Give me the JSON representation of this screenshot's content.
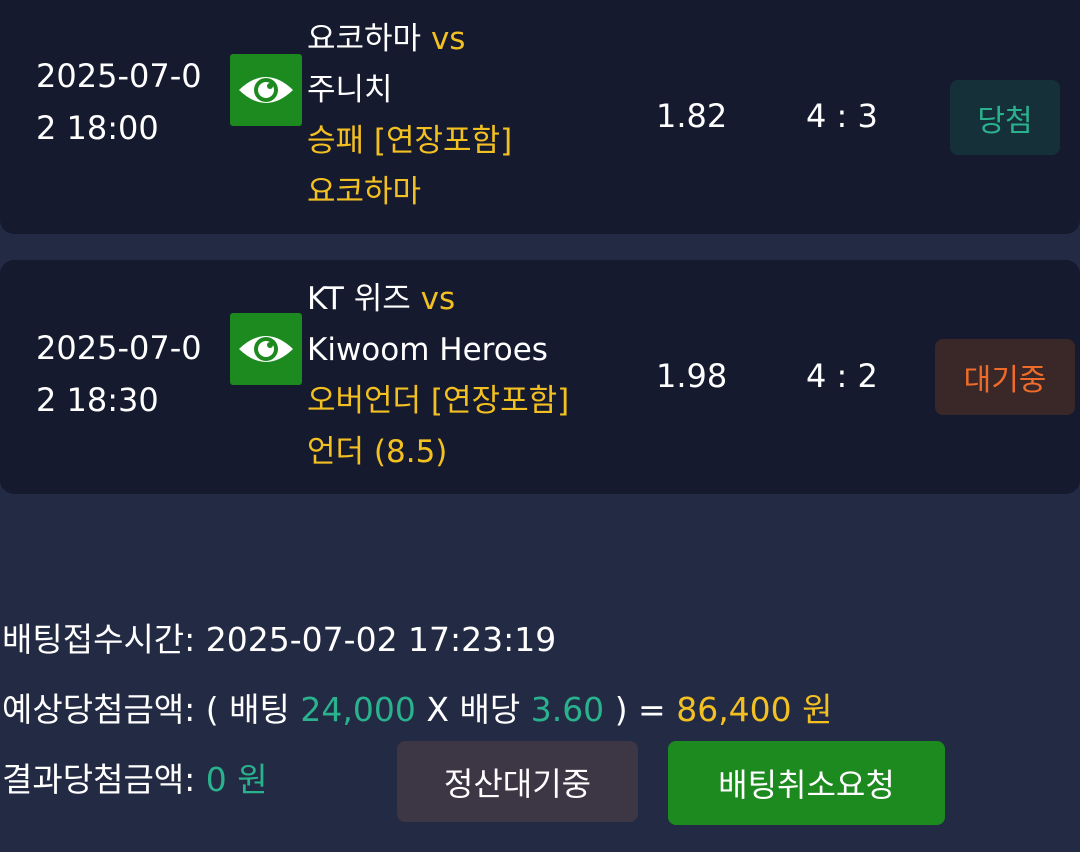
{
  "bets": [
    {
      "datetime": "2025-07-02 18:00",
      "eye_icon": "eye-icon",
      "home_team": "요코하마",
      "vs": "vs",
      "away_team": "주니치",
      "market": "승패 [연장포함]",
      "pick": "요코하마",
      "odds": "1.82",
      "score": "4 : 3",
      "status": "당첨",
      "status_color": "#2ab28e"
    },
    {
      "datetime": "2025-07-02 18:30",
      "eye_icon": "eye-icon",
      "home_team": "KT 위즈",
      "vs": "vs",
      "away_team": "Kiwoom Heroes",
      "market": "오버언더 [연장포함]",
      "pick": "언더 (8.5)",
      "odds": "1.98",
      "score": "4 : 2",
      "status": "대기중",
      "status_color": "#ef6b2a"
    }
  ],
  "summary": {
    "time_label": "배팅접수시간:",
    "time_value": "2025-07-02 17:23:19",
    "expected_label": "예상당첨금액:",
    "open_paren": "(",
    "bet_label": "배팅",
    "bet_amount": "24,000",
    "times": "X",
    "odds_label": "배당",
    "total_odds": "3.60",
    "close_paren_eq": ") =",
    "expected_amount": "86,400 원",
    "result_label": "결과당첨금액:",
    "result_amount": "0 원"
  },
  "buttons": {
    "settle_label": "정산대기중",
    "cancel_label": "배팅취소요청"
  },
  "colors": {
    "background": "#232a44",
    "card": "#151a2e",
    "accent_yellow": "#f3c022",
    "accent_teal": "#2ab28e",
    "green_button": "#1c8a1f"
  }
}
